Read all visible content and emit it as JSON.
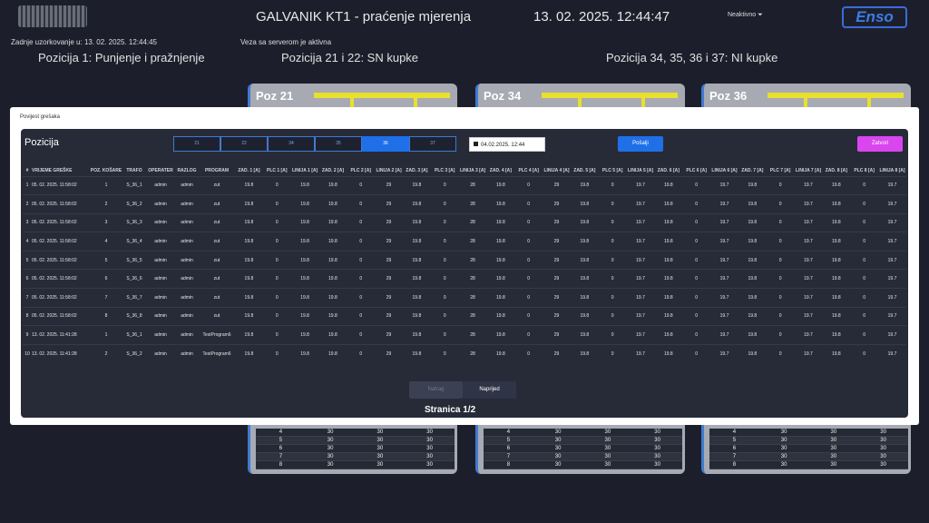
{
  "header": {
    "title": "GALVANIK KT1 - praćenje mjerenja",
    "clock": "13. 02. 2025. 12:44:47",
    "user_menu": "Neaktivno ⏷",
    "brand": "Enso"
  },
  "status": {
    "last_sample": "Zadnje uzorkovanje u: 13. 02. 2025. 12:44:45",
    "server": "Veza sa serverom je aktivna"
  },
  "positions": {
    "heading_1": "Pozicija 1: Punjenje i pražnjenje",
    "heading_2": "Pozicija 21 i 22: SN kupke",
    "heading_3": "Pozicija 34, 35, 36 i 37: NI kupke"
  },
  "cards": [
    {
      "title": "Poz 21"
    },
    {
      "title": "Poz 34"
    },
    {
      "title": "Poz 36"
    }
  ],
  "card_rows": [
    [
      "4",
      "30",
      "30",
      "30"
    ],
    [
      "5",
      "30",
      "30",
      "30"
    ],
    [
      "6",
      "30",
      "30",
      "30"
    ],
    [
      "7",
      "30",
      "30",
      "30"
    ],
    [
      "8",
      "30",
      "30",
      "30"
    ]
  ],
  "modal": {
    "title": "Povijest grešaka",
    "panel_title": "Pozicija",
    "tabs": [
      "21",
      "22",
      "34",
      "35",
      "36",
      "37"
    ],
    "active_tab": "36",
    "date_value": "04.02.2025. 12:44",
    "send_label": "Pošalji",
    "close_label": "Zatvori",
    "prev_label": "Natrag",
    "next_label": "Naprijed",
    "page_label": "Stranica 1/2"
  },
  "columns": [
    "#",
    "VRIJEME GREŠKE",
    "POZ. KOŠARE",
    "TRAFO",
    "OPERATER",
    "RAZLOG",
    "PROGRAM",
    "ZAD. 1 [A]",
    "PLC 1 [A]",
    "LINIJA 1 [A]",
    "ZAD. 2 [A]",
    "PLC 2 [A]",
    "LINIJA 2 [A]",
    "ZAD. 3 [A]",
    "PLC 3 [A]",
    "LINIJA 3 [A]",
    "ZAD. 4 [A]",
    "PLC 4 [A]",
    "LINIJA 4 [A]",
    "ZAD. 5 [A]",
    "PLC 5 [A]",
    "LINIJA 5 [A]",
    "ZAD. 6 [A]",
    "PLC 6 [A]",
    "LINIJA 6 [A]",
    "ZAD. 7 [A]",
    "PLC 7 [A]",
    "LINIJA 7 [A]",
    "ZAD. 8 [A]",
    "PLC 8 [A]",
    "LINIJA 8 [A]"
  ],
  "rows": [
    [
      "1",
      "05. 02. 2025. 11:58:02",
      "1",
      "S_36_1",
      "admin",
      "admin",
      "zut",
      "19.8",
      "0",
      "19.8",
      "19.8",
      "0",
      "29",
      "19.8",
      "0",
      "28",
      "19.8",
      "0",
      "29",
      "19.8",
      "0",
      "19.7",
      "19.8",
      "0",
      "19.7",
      "19.8",
      "0",
      "19.7",
      "19.8",
      "0",
      "19.7"
    ],
    [
      "2",
      "05. 02. 2025. 11:58:02",
      "2",
      "S_36_2",
      "admin",
      "admin",
      "zut",
      "19.8",
      "0",
      "19.8",
      "19.8",
      "0",
      "29",
      "19.8",
      "0",
      "28",
      "19.8",
      "0",
      "29",
      "19.8",
      "0",
      "19.7",
      "19.8",
      "0",
      "19.7",
      "19.8",
      "0",
      "19.7",
      "19.8",
      "0",
      "19.7"
    ],
    [
      "3",
      "05. 02. 2025. 11:58:02",
      "3",
      "S_36_3",
      "admin",
      "admin",
      "zut",
      "19.8",
      "0",
      "19.8",
      "19.8",
      "0",
      "29",
      "19.8",
      "0",
      "28",
      "19.8",
      "0",
      "29",
      "19.8",
      "0",
      "19.7",
      "19.8",
      "0",
      "19.7",
      "19.8",
      "0",
      "19.7",
      "19.8",
      "0",
      "19.7"
    ],
    [
      "4",
      "05. 02. 2025. 11:58:02",
      "4",
      "S_36_4",
      "admin",
      "admin",
      "zut",
      "19.8",
      "0",
      "19.8",
      "19.8",
      "0",
      "29",
      "19.8",
      "0",
      "28",
      "19.8",
      "0",
      "29",
      "19.8",
      "0",
      "19.7",
      "19.8",
      "0",
      "19.7",
      "19.8",
      "0",
      "19.7",
      "19.8",
      "0",
      "19.7"
    ],
    [
      "5",
      "05. 02. 2025. 11:58:02",
      "5",
      "S_36_5",
      "admin",
      "admin",
      "zut",
      "19.8",
      "0",
      "19.8",
      "19.8",
      "0",
      "29",
      "19.8",
      "0",
      "28",
      "19.8",
      "0",
      "29",
      "19.8",
      "0",
      "19.7",
      "19.8",
      "0",
      "19.7",
      "19.8",
      "0",
      "19.7",
      "19.8",
      "0",
      "19.7"
    ],
    [
      "6",
      "05. 02. 2025. 11:58:02",
      "6",
      "S_36_6",
      "admin",
      "admin",
      "zut",
      "19.8",
      "0",
      "19.8",
      "19.8",
      "0",
      "29",
      "19.8",
      "0",
      "28",
      "19.8",
      "0",
      "29",
      "19.8",
      "0",
      "19.7",
      "19.8",
      "0",
      "19.7",
      "19.8",
      "0",
      "19.7",
      "19.8",
      "0",
      "19.7"
    ],
    [
      "7",
      "05. 02. 2025. 11:58:02",
      "7",
      "S_36_7",
      "admin",
      "admin",
      "zut",
      "19.8",
      "0",
      "19.8",
      "19.8",
      "0",
      "29",
      "19.8",
      "0",
      "28",
      "19.8",
      "0",
      "29",
      "19.8",
      "0",
      "19.7",
      "19.8",
      "0",
      "19.7",
      "19.8",
      "0",
      "19.7",
      "19.8",
      "0",
      "19.7"
    ],
    [
      "8",
      "05. 02. 2025. 11:58:02",
      "8",
      "S_36_8",
      "admin",
      "admin",
      "zut",
      "19.8",
      "0",
      "19.8",
      "19.8",
      "0",
      "29",
      "19.8",
      "0",
      "28",
      "19.8",
      "0",
      "29",
      "19.8",
      "0",
      "19.7",
      "19.8",
      "0",
      "19.7",
      "19.8",
      "0",
      "19.7",
      "19.8",
      "0",
      "19.7"
    ],
    [
      "9",
      "13. 02. 2025. 11:41:28",
      "1",
      "S_36_1",
      "admin",
      "admin",
      "TestProgram6",
      "19.8",
      "0",
      "19.8",
      "19.8",
      "0",
      "29",
      "19.8",
      "0",
      "28",
      "19.8",
      "0",
      "29",
      "19.8",
      "0",
      "19.7",
      "19.8",
      "0",
      "19.7",
      "19.8",
      "0",
      "19.7",
      "19.8",
      "0",
      "19.7"
    ],
    [
      "10",
      "13. 02. 2025. 11:41:28",
      "2",
      "S_36_2",
      "admin",
      "admin",
      "TestProgram6",
      "19.8",
      "0",
      "19.8",
      "19.8",
      "0",
      "29",
      "19.8",
      "0",
      "28",
      "19.8",
      "0",
      "29",
      "19.8",
      "0",
      "19.7",
      "19.8",
      "0",
      "19.7",
      "19.8",
      "0",
      "19.7",
      "19.8",
      "0",
      "19.7"
    ]
  ]
}
